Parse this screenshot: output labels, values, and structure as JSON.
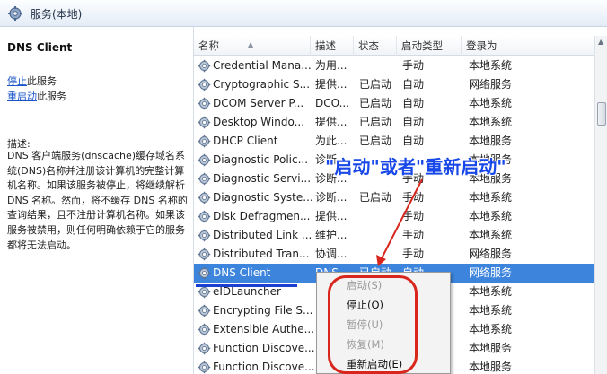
{
  "window": {
    "title": "服务(本地)"
  },
  "left_panel": {
    "service_name": "DNS Client",
    "stop_link": "停止",
    "stop_suffix": "此服务",
    "restart_link": "重启动",
    "restart_suffix": "此服务",
    "desc_label": "描述:",
    "desc_text": "DNS 客户端服务(dnscache)缓存域名系统(DNS)名称并注册该计算机的完整计算机名称。如果该服务被停止，将继续解析 DNS 名称。然而，将不缓存 DNS 名称的查询结果，且不注册计算机名称。如果该服务被禁用，则任何明确依赖于它的服务都将无法启动。"
  },
  "columns": {
    "name": "名称",
    "desc": "描述",
    "status": "状态",
    "startup": "启动类型",
    "logon": "登录为"
  },
  "rows": [
    {
      "name": "Credential Mana...",
      "desc": "为用...",
      "status": "",
      "startup": "手动",
      "logon": "本地系统"
    },
    {
      "name": "Cryptographic S...",
      "desc": "提供...",
      "status": "已启动",
      "startup": "自动",
      "logon": "网络服务"
    },
    {
      "name": "DCOM Server P...",
      "desc": "DCO...",
      "status": "已启动",
      "startup": "自动",
      "logon": "本地系统"
    },
    {
      "name": "Desktop Windo...",
      "desc": "提供...",
      "status": "已启动",
      "startup": "自动",
      "logon": "本地系统"
    },
    {
      "name": "DHCP Client",
      "desc": "为此...",
      "status": "已启动",
      "startup": "自动",
      "logon": "本地服务"
    },
    {
      "name": "Diagnostic Polic...",
      "desc": "诊断...",
      "status": "",
      "startup": "",
      "logon": "本地服务"
    },
    {
      "name": "Diagnostic Servi...",
      "desc": "诊断...",
      "status": "",
      "startup": "手动",
      "logon": "本地服务"
    },
    {
      "name": "Diagnostic Syste...",
      "desc": "诊断...",
      "status": "已启动",
      "startup": "手动",
      "logon": "本地系统"
    },
    {
      "name": "Disk Defragmen...",
      "desc": "提供...",
      "status": "",
      "startup": "手动",
      "logon": "本地系统"
    },
    {
      "name": "Distributed Link ...",
      "desc": "维护...",
      "status": "",
      "startup": "手动",
      "logon": "本地系统"
    },
    {
      "name": "Distributed Tran...",
      "desc": "协调...",
      "status": "",
      "startup": "手动",
      "logon": "网络服务"
    },
    {
      "name": "DNS Client",
      "desc": "DNS...",
      "status": "已启动",
      "startup": "自动",
      "logon": "网络服务"
    },
    {
      "name": "eIDLauncher",
      "desc": "",
      "status": "",
      "startup": "",
      "logon": "本地系统"
    },
    {
      "name": "Encrypting File S...",
      "desc": "",
      "status": "",
      "startup": "",
      "logon": "本地系统"
    },
    {
      "name": "Extensible Authe...",
      "desc": "",
      "status": "",
      "startup": "",
      "logon": "本地系统"
    },
    {
      "name": "Function Discove...",
      "desc": "",
      "status": "",
      "startup": "",
      "logon": "本地服务"
    },
    {
      "name": "Function Discove...",
      "desc": "",
      "status": "",
      "startup": "",
      "logon": "本地服务"
    }
  ],
  "context_menu": {
    "items": [
      "启动(S)",
      "停止(O)",
      "暂停(U)",
      "恢复(M)",
      "重新启动(E)"
    ]
  },
  "annotation": {
    "text": "\"启动\"或者\"重新启动\""
  },
  "colors": {
    "selected": "#3d84dc",
    "annotation": "#1948e8",
    "highlight": "#d9261c"
  },
  "icons": {
    "header": "gear-icon",
    "service": "service-gear-icon"
  }
}
